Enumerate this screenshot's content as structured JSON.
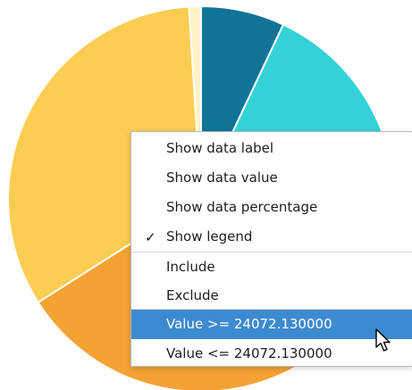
{
  "chart_data": {
    "type": "pie",
    "slices": [
      {
        "fraction": 0.07,
        "color": "#0f7498"
      },
      {
        "fraction": 0.16,
        "color": "#34d2d7"
      },
      {
        "fraction": 0.43,
        "color": "#f5a235"
      },
      {
        "fraction": 0.33,
        "color": "#fbcd52"
      },
      {
        "fraction": 0.01,
        "color": "#fff2c8"
      }
    ]
  },
  "context_menu": {
    "items": [
      {
        "label": "Show data label",
        "checked": false
      },
      {
        "label": "Show data value",
        "checked": false
      },
      {
        "label": "Show data percentage",
        "checked": false
      },
      {
        "label": "Show legend",
        "checked": true
      },
      {
        "label": "Include",
        "checked": false
      },
      {
        "label": "Exclude",
        "checked": false
      },
      {
        "label": "Value >= 24072.130000",
        "checked": false,
        "highlighted": true
      },
      {
        "label": "Value <= 24072.130000",
        "checked": false
      }
    ],
    "check_glyph": "✓"
  },
  "colors": {
    "highlight": "#3d8ad0"
  }
}
